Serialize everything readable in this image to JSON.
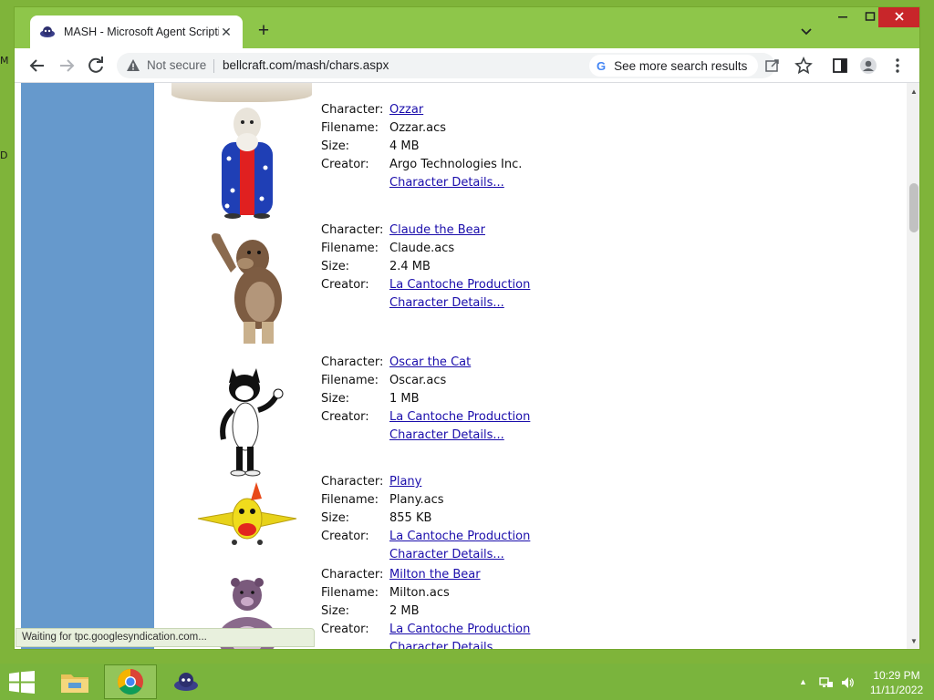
{
  "browser": {
    "tab_title": "MASH - Microsoft Agent Scripting Helper",
    "new_tab": "+",
    "tab_close": "✕",
    "security_label": "Not secure",
    "url": "bellcraft.com/mash/chars.aspx",
    "search_pill": "See more search results",
    "status": "Waiting for tpc.googlesyndication.com..."
  },
  "labels": {
    "character": "Character:",
    "filename": "Filename:",
    "size": "Size:",
    "creator": "Creator:",
    "details": "Character Details..."
  },
  "characters": [
    {
      "name": "Ozzar",
      "filename": "Ozzar.acs",
      "size": "4 MB",
      "creator": "Argo Technologies Inc.",
      "creator_is_link": false
    },
    {
      "name": "Claude the Bear",
      "filename": "Claude.acs",
      "size": "2.4 MB",
      "creator": "La Cantoche Production",
      "creator_is_link": true
    },
    {
      "name": "Oscar the Cat",
      "filename": "Oscar.acs",
      "size": "1 MB",
      "creator": "La Cantoche Production",
      "creator_is_link": true
    },
    {
      "name": "Plany",
      "filename": "Plany.acs",
      "size": "855 KB",
      "creator": "La Cantoche Production",
      "creator_is_link": true
    },
    {
      "name": "Milton the Bear",
      "filename": "Milton.acs",
      "size": "2 MB",
      "creator": "La Cantoche Production",
      "creator_is_link": true
    }
  ],
  "taskbar": {
    "time": "10:29 PM",
    "date": "11/11/2022"
  },
  "colors": {
    "accent_green": "#8ec64a",
    "sidebar_blue": "#6699cc",
    "link": "#1a0dab"
  }
}
